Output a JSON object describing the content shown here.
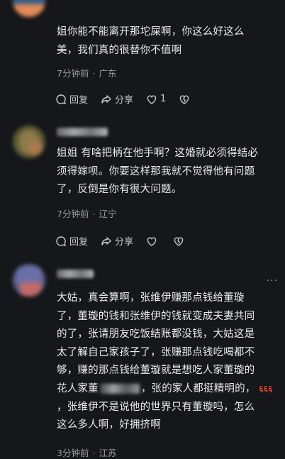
{
  "comments": [
    {
      "lines": [
        "姐你能不能离开那坨屎啊，你这么好这么",
        "美，我们真的很替你不值啊"
      ],
      "time": "7分钟前",
      "location": "广东",
      "reply_label": "回复",
      "share_label": "分享",
      "like_count": "1",
      "avatar_colors": [
        "#3b5f86",
        "#e08a57"
      ]
    },
    {
      "lines": [
        "姐姐 有啥把柄在他手啊？这婚就必须得结必",
        "须得嫁呗。你要这样那我就不觉得他有问题",
        "了，反倒是你有很大问题。"
      ],
      "time": "7分钟前",
      "location": "辽宁",
      "reply_label": "回复",
      "share_label": "分享",
      "avatar_colors": [
        "#6f6e3c",
        "#a8784f"
      ]
    },
    {
      "lines": [
        "大姑，真会算啊，张维伊赚那点钱给董璇",
        "了，董璇的钱和张维伊的钱就变成夫妻共同",
        "的了，张请朋友吃饭结账都没钱，大姑这是",
        "太了解自己家孩子了，张赚那点钱吃喝都不",
        "够，赚的那点钱给董璇就是想吃人家董璇的"
      ],
      "line6_before": "花人家董",
      "line6_after": "，张的家人都挺精明的，",
      "line6_emoji": "६६६",
      "lines_tail": [
        "，张维伊不是说他的世界只有董璇吗，怎么",
        "这么多人啊，好拥挤啊"
      ],
      "time": "3分钟前",
      "location": "江苏",
      "more_label": "···",
      "avatar_colors": [
        "#6a6fa8",
        "#c06a6a"
      ]
    }
  ]
}
